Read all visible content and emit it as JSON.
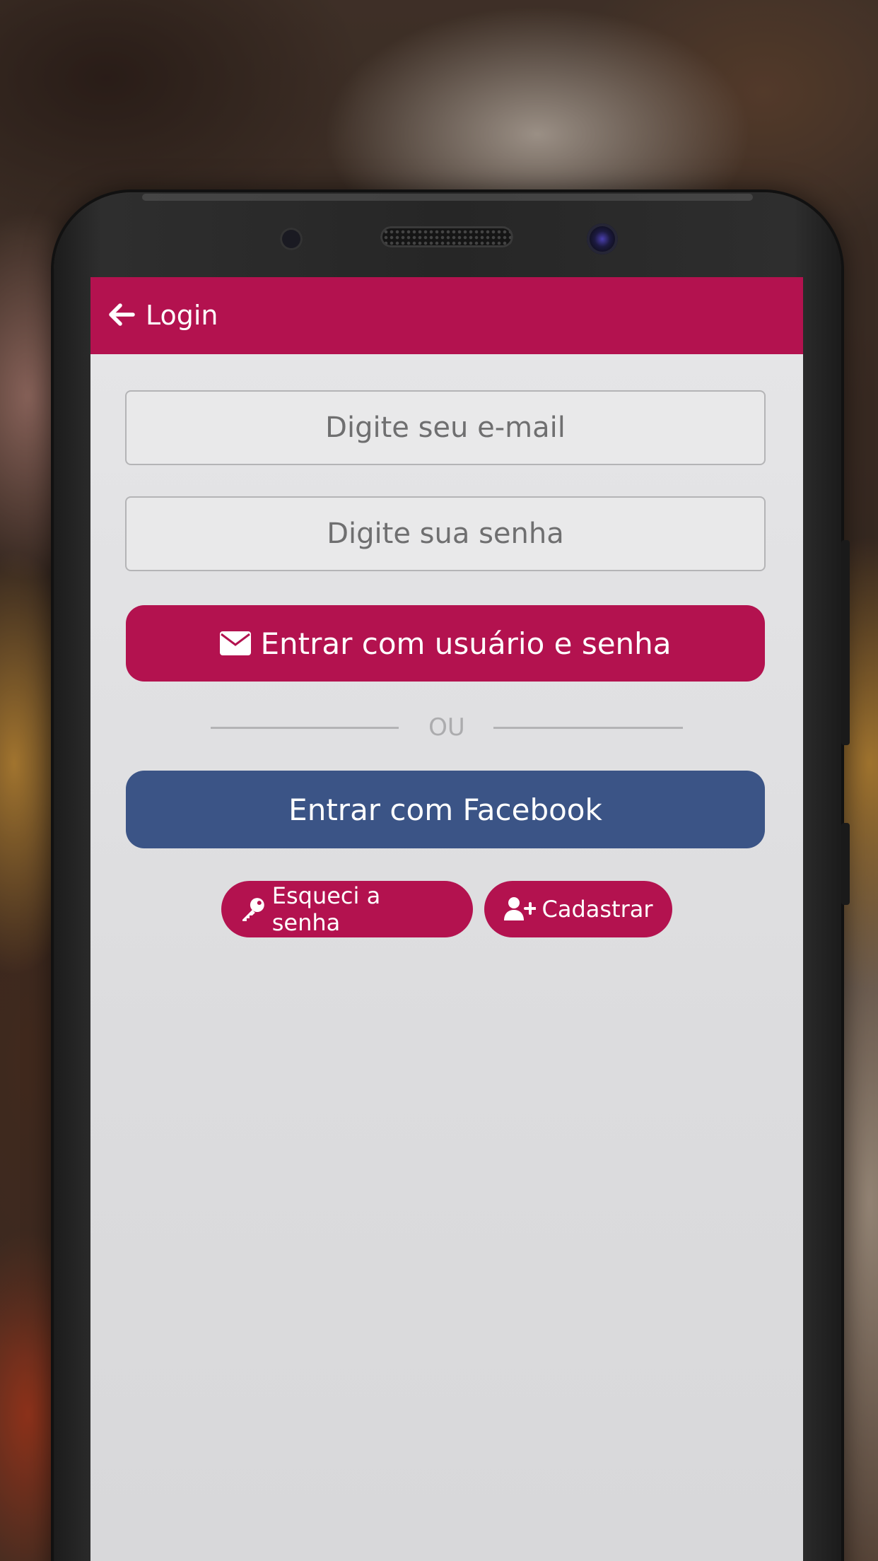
{
  "header": {
    "title": "Login"
  },
  "form": {
    "email_placeholder": "Digite seu e-mail",
    "password_placeholder": "Digite sua senha",
    "login_button_label": "Entrar com usuário e senha",
    "divider_text": "OU",
    "facebook_button_label": "Entrar com Facebook",
    "forgot_password_label": "Esqueci a senha",
    "register_label": "Cadastrar"
  },
  "colors": {
    "primary": "#b3124f",
    "facebook": "#3b5486",
    "screen_background": "#e3e3e5"
  },
  "icons": {
    "back": "arrow-left-icon",
    "login": "envelope-icon",
    "forgot": "key-icon",
    "register": "user-plus-icon"
  }
}
